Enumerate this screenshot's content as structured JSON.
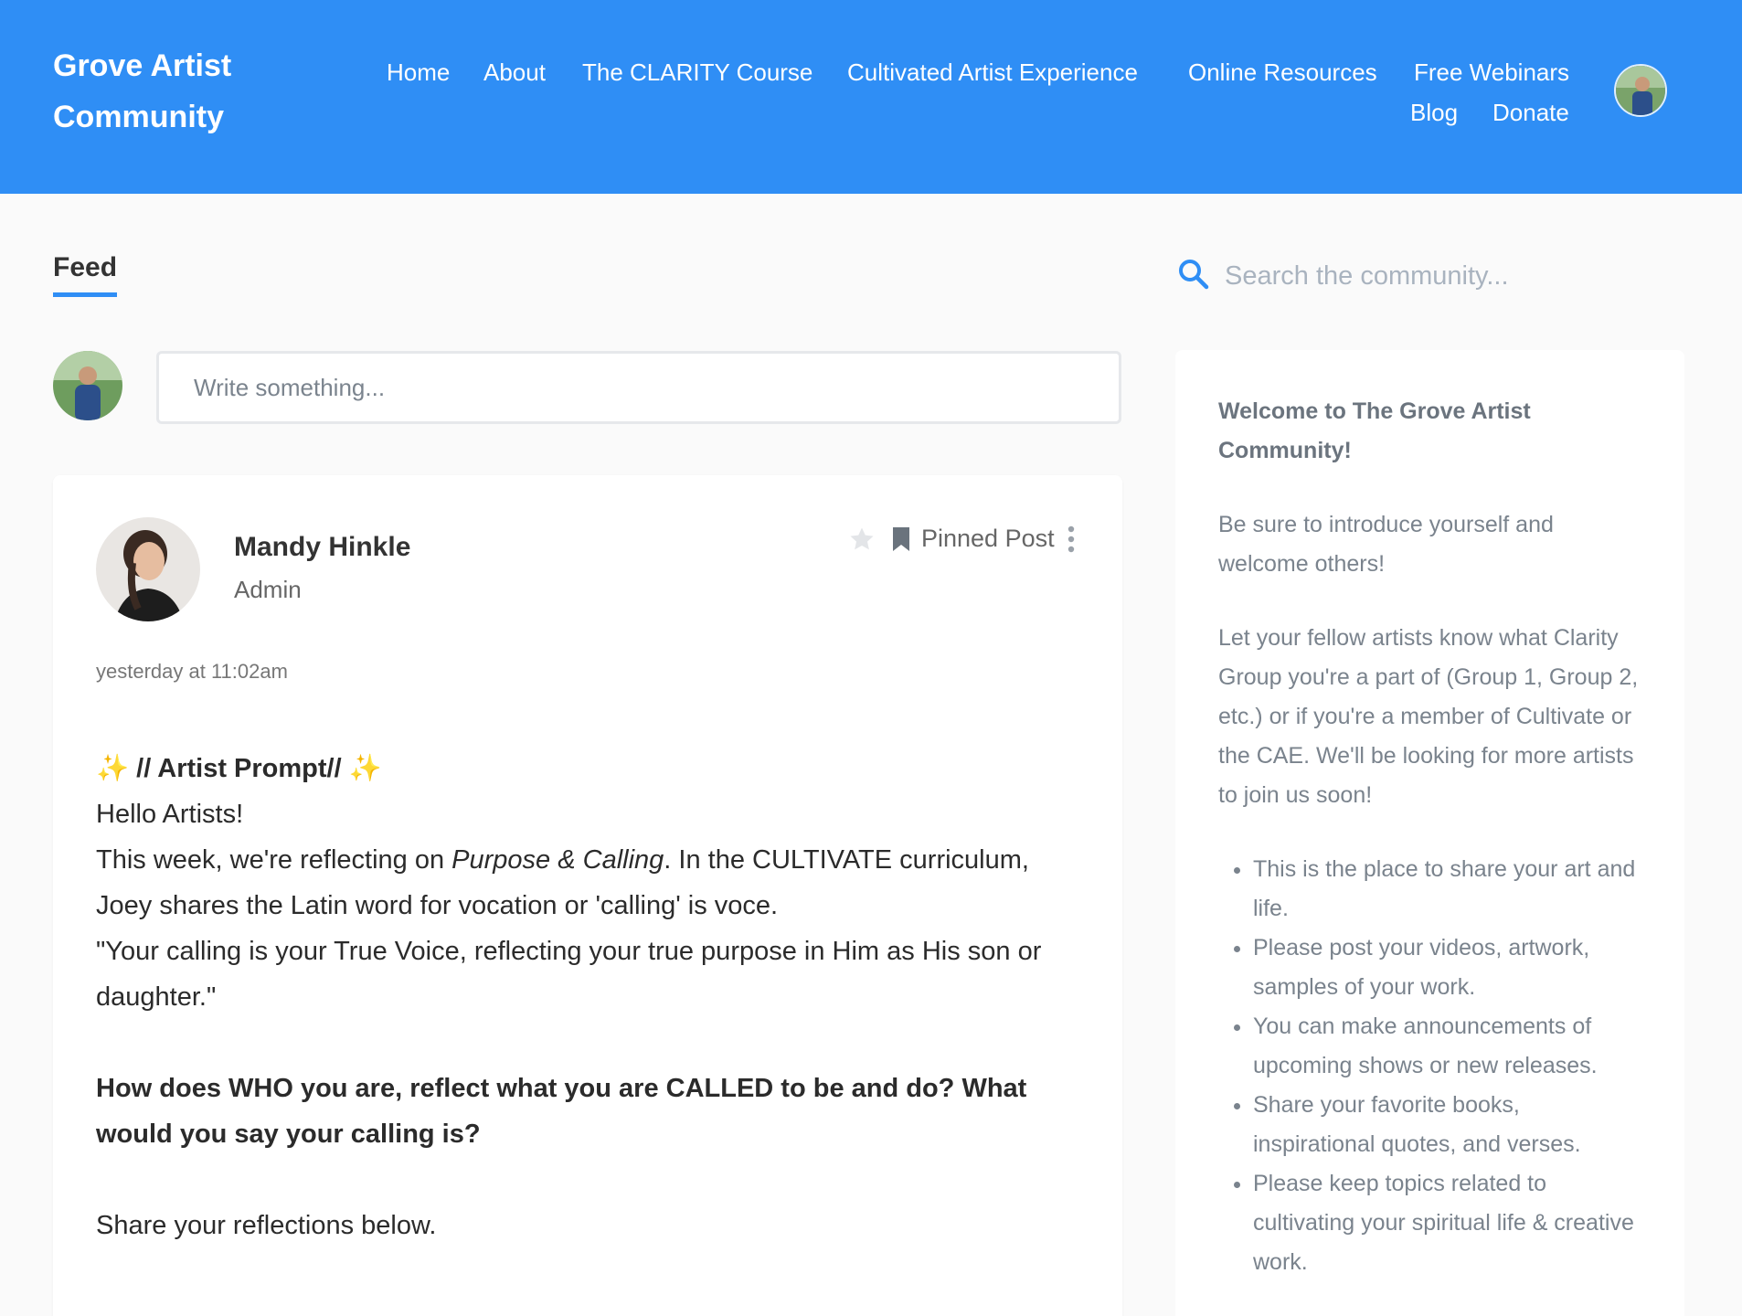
{
  "header": {
    "brand": "Grove Artist Community",
    "nav": [
      "Home",
      "About",
      "The CLARITY Course",
      "Cultivated Artist Experience",
      "Online Resources",
      "Free Webinars",
      "Blog",
      "Donate"
    ]
  },
  "feed": {
    "tab_label": "Feed",
    "composer_placeholder": "Write something...",
    "post": {
      "author": "Mandy Hinkle",
      "role": "Admin",
      "pinned_label": "Pinned Post",
      "timestamp": "yesterday at 11:02am",
      "prompt_title": " // Artist Prompt// ",
      "greeting": "Hello Artists!",
      "line1_pre": "This week, we're reflecting on ",
      "line1_em": "Purpose & Calling",
      "line1_post": ". In the CULTIVATE curriculum, Joey shares the Latin word for vocation or 'calling' is voce.",
      "quote": "\"Your calling is your True Voice, reflecting your true purpose in Him as His son or daughter.\"",
      "question": "How does WHO you are, reflect what you are CALLED to be and do? What would you say your calling is?",
      "closing": "Share your reflections below."
    }
  },
  "search": {
    "placeholder": "Search the community..."
  },
  "sidebar": {
    "title": "Welcome to The Grove Artist Community!",
    "intro": "Be sure to introduce yourself and welcome others!",
    "para2": "Let your fellow artists know what Clarity Group you're a part of (Group 1, Group 2, etc.) or if you're a member of Cultivate or the CAE. We'll be looking for more artists to join us soon!",
    "bullets": [
      "This is the place to share your art and life.",
      "Please post your videos, artwork, samples of your work.",
      "You can make announcements of upcoming shows or new releases.",
      "Share your favorite books, inspirational quotes, and verses.",
      "Please keep topics related to cultivating your spiritual life & creative work."
    ]
  },
  "colors": {
    "header": "#2f8ef5",
    "accent": "#2f8ef5",
    "background": "#fafafa"
  }
}
